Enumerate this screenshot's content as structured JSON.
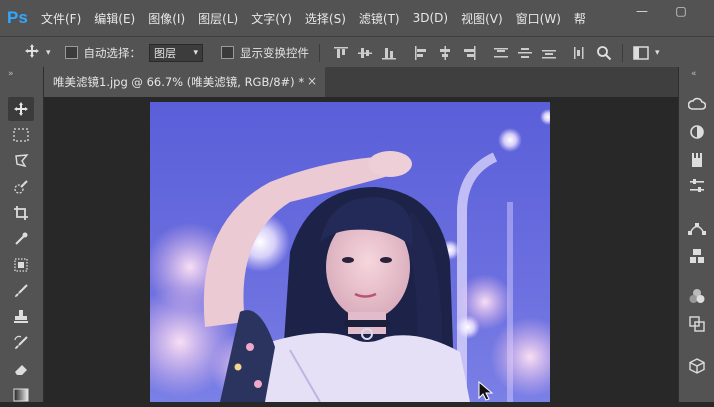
{
  "app": {
    "logo": "Ps"
  },
  "menu": [
    "文件(F)",
    "编辑(E)",
    "图像(I)",
    "图层(L)",
    "文字(Y)",
    "选择(S)",
    "滤镜(T)",
    "3D(D)",
    "视图(V)",
    "窗口(W)",
    "帮"
  ],
  "options_bar": {
    "auto_select_label": "自动选择：",
    "auto_select_value": "图层",
    "show_transform_label": "显示变换控件"
  },
  "document_tab": {
    "title": "唯美滤镜1.jpg @ 66.7% (唯美滤镜, RGB/8#) *",
    "close": "×"
  },
  "window_controls": {
    "minimize": "—",
    "maximize": "▢"
  },
  "colors": {
    "chrome": "#535353",
    "canvas_bg": "#282828",
    "accent": "#31a8ff"
  },
  "icons": {
    "tools": [
      "move-icon",
      "marquee-icon",
      "lasso-icon",
      "quick-select-icon",
      "crop-icon",
      "eyedropper-icon",
      "patch-icon",
      "brush-icon",
      "stamp-icon",
      "history-brush-icon",
      "eraser-icon",
      "gradient-icon"
    ],
    "right_panel": [
      "creative-cloud-icon",
      "adjustments-icon",
      "libraries-icon",
      "properties-icon",
      "paths-icon",
      "3d-layers-icon",
      "channels-icon",
      "transform-icon",
      "cube-icon"
    ]
  }
}
